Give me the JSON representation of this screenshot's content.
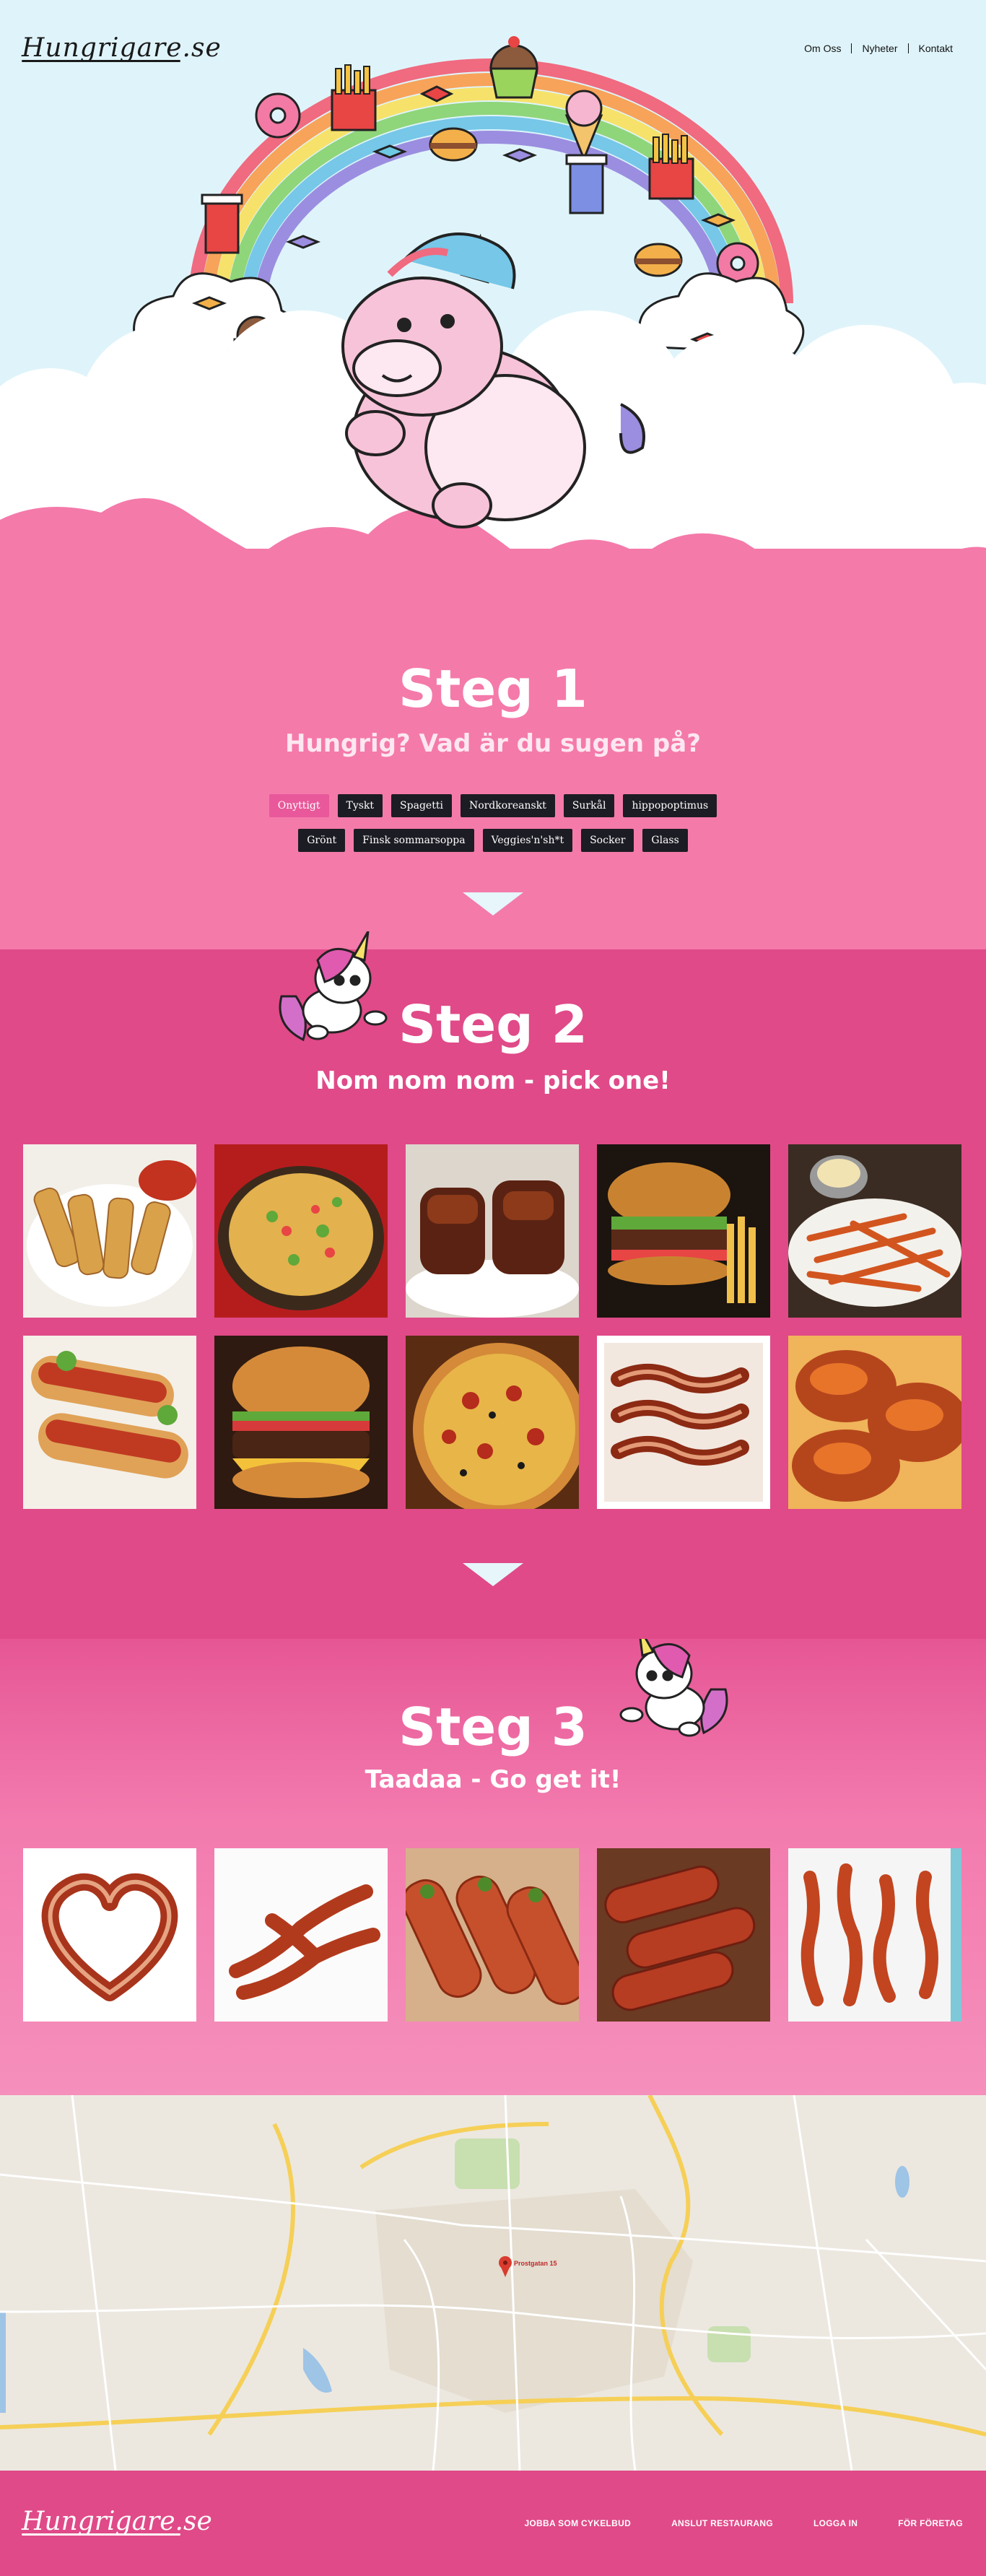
{
  "header": {
    "logo": "Hungrigare.se",
    "nav": [
      "Om Oss",
      "Nyheter",
      "Kontakt"
    ]
  },
  "step1": {
    "title": "Steg 1",
    "subtitle": "Hungrig? Vad är du sugen på?",
    "tags_row1": [
      "Onyttigt",
      "Tyskt",
      "Spagetti",
      "Nordkoreanskt",
      "Surkål",
      "hippopoptimus"
    ],
    "tags_row2": [
      "Grönt",
      "Finsk sommarsoppa",
      "Veggies'n'sh*t",
      "Socker",
      "Glass"
    ],
    "active_tag": "Onyttigt"
  },
  "step2": {
    "title": "Steg 2",
    "subtitle": "Nom nom nom - pick one!",
    "foods": [
      "mozzarella-sticks",
      "nachos",
      "ribs",
      "burger-fries",
      "sweet-potato-fries",
      "hot-dogs",
      "cheeseburger",
      "pizza",
      "bacon",
      "chicken-wings"
    ],
    "selected": "bacon"
  },
  "step3": {
    "title": "Steg 3",
    "subtitle": "Taadaa - Go get it!",
    "results": [
      "bacon-heart",
      "bacon-strips",
      "bacon-wrapped-asparagus",
      "bacon-rolls",
      "bacon-slices"
    ]
  },
  "map": {
    "pin_label": "Prostgatan 15"
  },
  "footer": {
    "logo": "Hungrigare.se",
    "links": [
      "JOBBA SOM CYKELBUD",
      "ANSLUT RESTAURANG",
      "LOGGA IN",
      "FÖR FÖRETAG"
    ]
  },
  "colors": {
    "pink_light": "#f47aaa",
    "pink_dark": "#e04a88",
    "sky": "#dff4fa",
    "tag_bg": "#1c1c24",
    "tag_active": "#e8589a"
  }
}
